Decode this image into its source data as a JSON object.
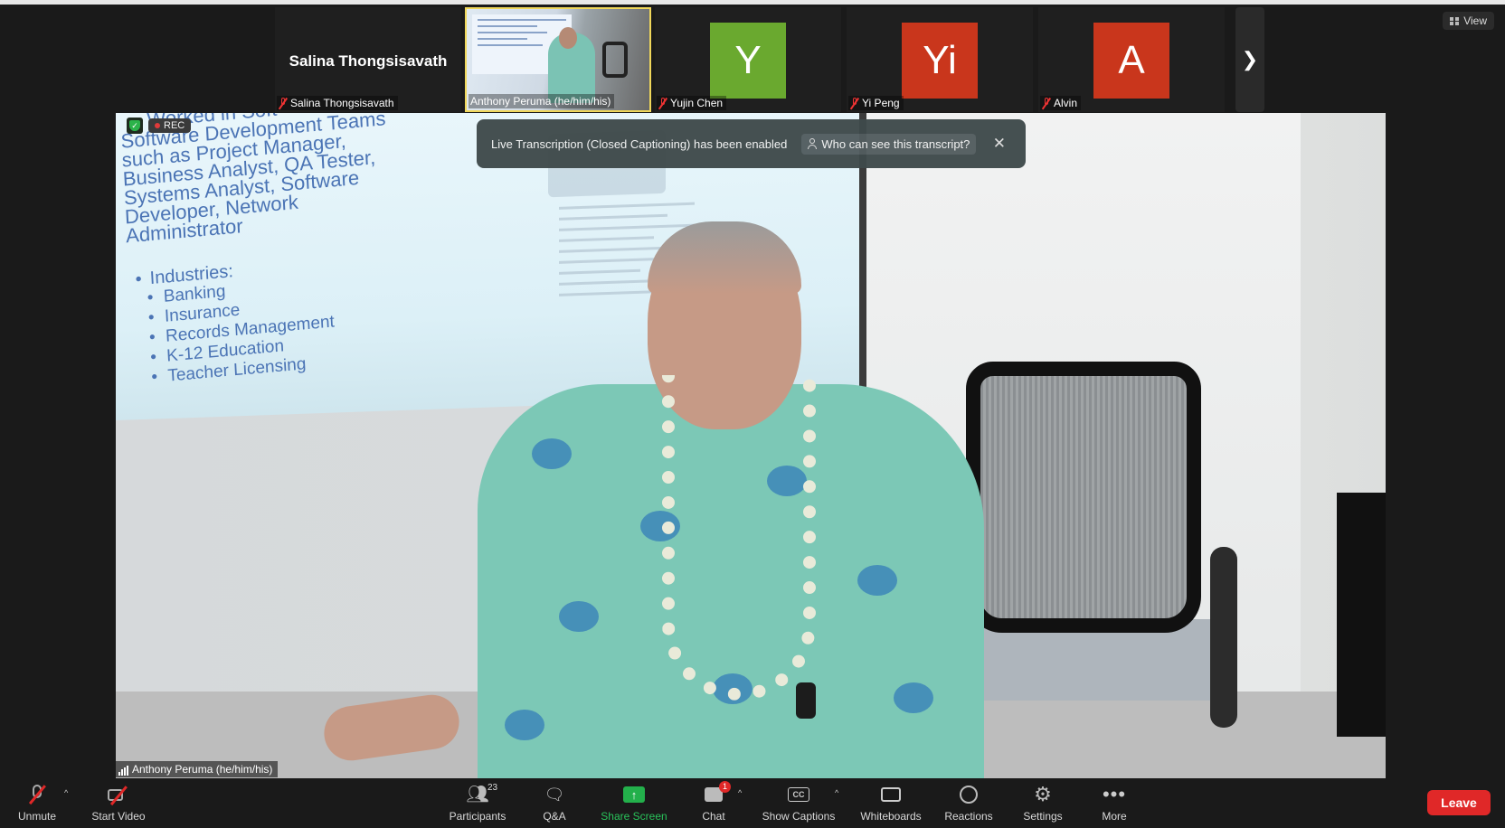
{
  "thumbnails": [
    {
      "big_name": "Salina Thongsisavath",
      "name": "Salina Thongsisavath",
      "muted": true
    },
    {
      "name": "Anthony Peruma (he/him/his)",
      "active": true
    },
    {
      "initial": "Y",
      "name": "Yujin Chen",
      "color": "#6aa92f",
      "muted": true
    },
    {
      "initial": "Yi",
      "name": "Yi Peng",
      "color": "#c9361c",
      "muted": true
    },
    {
      "initial": "A",
      "name": "Alvin",
      "color": "#c9361c",
      "muted": true
    }
  ],
  "view_label": "View",
  "recording": {
    "label": "REC"
  },
  "notification": {
    "message": "Live Transcription (Closed Captioning) has been enabled",
    "who_label": "Who can see this transcript?",
    "close_glyph": "✕"
  },
  "slide": {
    "lines": [
      "Worked in Soft",
      "Software Development Teams",
      "such as Project Manager,",
      "Business Analyst, QA Tester,",
      "Systems Analyst, Software",
      "Developer, Network",
      "Administrator"
    ],
    "list_heading": "Industries:",
    "list_items": [
      "Banking",
      "Insurance",
      "Records Management",
      "K-12 Education",
      "Teacher Licensing"
    ]
  },
  "speaker_name": "Anthony Peruma (he/him/his)",
  "toolbar": {
    "unmute": "Unmute",
    "start_video": "Start Video",
    "participants": "Participants",
    "participants_count": "23",
    "qa": "Q&A",
    "share_screen": "Share Screen",
    "chat": "Chat",
    "chat_badge": "1",
    "show_captions": "Show Captions",
    "cc_glyph": "CC",
    "whiteboards": "Whiteboards",
    "reactions": "Reactions",
    "settings": "Settings",
    "more": "More",
    "leave": "Leave"
  },
  "colors": {
    "accent_green": "#23b04b",
    "leave_red": "#e02828",
    "active_border": "#f0d75a"
  },
  "icons": [
    "mic-off-icon",
    "video-off-icon",
    "participants-icon",
    "qa-icon",
    "share-screen-icon",
    "chat-icon",
    "captions-icon",
    "whiteboard-icon",
    "reactions-icon",
    "settings-icon",
    "more-icon",
    "chevron-right-icon",
    "shield-icon",
    "grid-icon"
  ]
}
